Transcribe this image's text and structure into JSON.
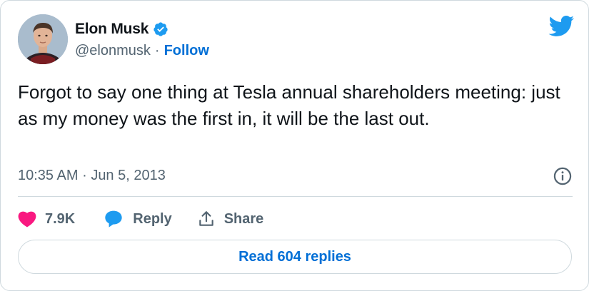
{
  "author": {
    "name": "Elon Musk",
    "handle": "@elonmusk",
    "separator": "·",
    "follow_label": "Follow",
    "verified": true
  },
  "tweet": {
    "text": "Forgot to say one thing at Tesla annual shareholders meeting: just as my money was the first in, it will be the last out.",
    "time": "10:35 AM",
    "date_separator": "·",
    "date": "Jun 5, 2013"
  },
  "actions": {
    "like_count": "7.9K",
    "reply_label": "Reply",
    "share_label": "Share"
  },
  "read_replies_label": "Read 604 replies",
  "colors": {
    "accent": "#006fd6",
    "twitter_blue": "#1d9bf0",
    "like": "#f91880",
    "muted": "#536471",
    "border": "#cfd9de"
  },
  "icons": {
    "brand": "twitter-bird-icon",
    "verified": "verified-badge-icon",
    "info": "info-icon",
    "like": "heart-icon",
    "reply": "speech-bubble-icon",
    "share": "share-upload-icon"
  }
}
